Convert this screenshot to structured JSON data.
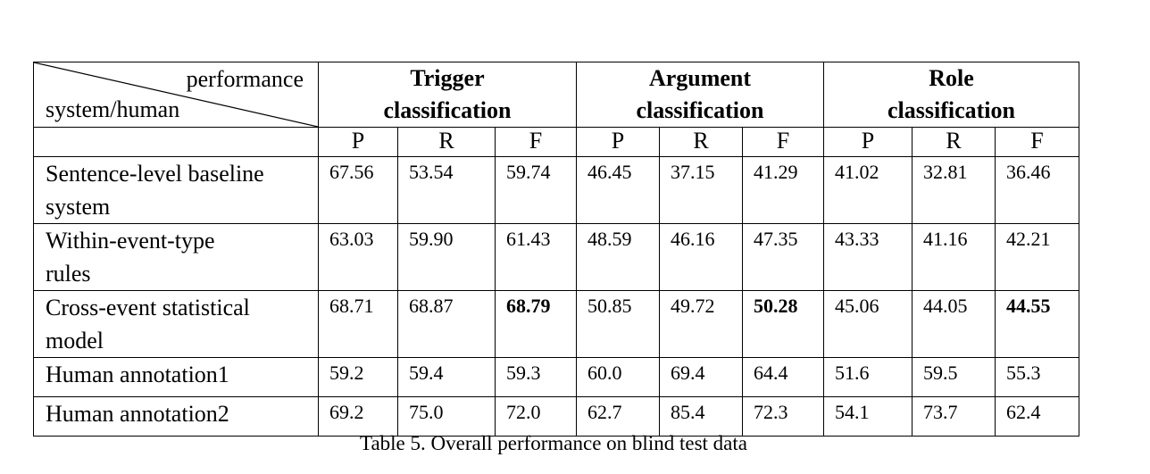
{
  "table": {
    "corner": {
      "top_right": "performance",
      "bottom_left": "system/human"
    },
    "groups": [
      {
        "line1": "Trigger",
        "line2": "classification"
      },
      {
        "line1": "Argument",
        "line2": "classification"
      },
      {
        "line1": "Role",
        "line2": "classification"
      }
    ],
    "subheaders": [
      "P",
      "R",
      "F",
      "P",
      "R",
      "F",
      "P",
      "R",
      "F"
    ],
    "rows": [
      {
        "label": "Sentence-level baseline system",
        "values": [
          "67.56",
          "53.54",
          "59.74",
          "46.45",
          "37.15",
          "41.29",
          "41.02",
          "32.81",
          "36.46"
        ],
        "bold": []
      },
      {
        "label": "Within-event-type rules",
        "values": [
          "63.03",
          "59.90",
          "61.43",
          "48.59",
          "46.16",
          "47.35",
          "43.33",
          "41.16",
          "42.21"
        ],
        "bold": []
      },
      {
        "label": "Cross-event statistical model",
        "values": [
          "68.71",
          "68.87",
          "68.79",
          "50.85",
          "49.72",
          "50.28",
          "45.06",
          "44.05",
          "44.55"
        ],
        "bold": [
          2,
          5,
          8
        ]
      },
      {
        "label": "Human annotation1",
        "values": [
          "59.2",
          "59.4",
          "59.3",
          "60.0",
          "69.4",
          "64.4",
          "51.6",
          "59.5",
          "55.3"
        ],
        "bold": []
      },
      {
        "label": "Human annotation2",
        "values": [
          "69.2",
          "75.0",
          "72.0",
          "62.7",
          "85.4",
          "72.3",
          "54.1",
          "73.7",
          "62.4"
        ],
        "bold": []
      }
    ]
  },
  "caption": "Table 5. Overall performance on blind test data"
}
